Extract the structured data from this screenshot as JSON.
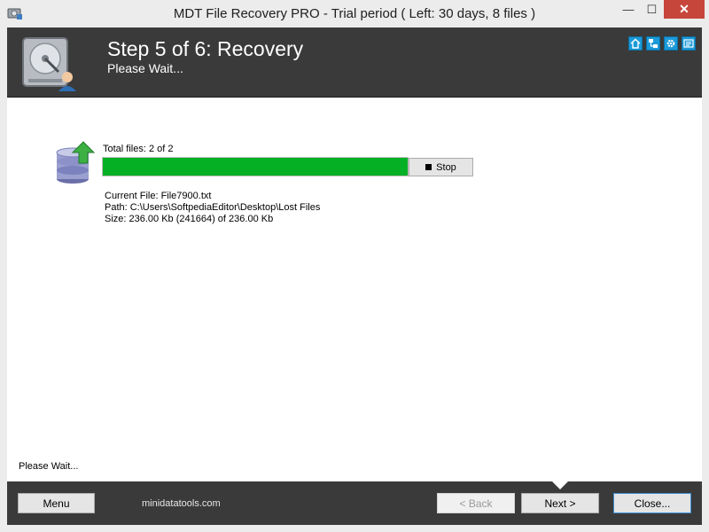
{
  "window": {
    "title": "MDT File Recovery PRO - Trial period ( Left: 30 days, 8 files )",
    "minimize_glyph": "—",
    "maximize_glyph": "☐",
    "close_glyph": "✕"
  },
  "header": {
    "step_title": "Step 5 of 6: Recovery",
    "step_subtitle": "Please Wait...",
    "icons": [
      "home-icon",
      "network-icon",
      "gear-icon",
      "info-card-icon"
    ]
  },
  "progress": {
    "total_label": "Total files: 2 of 2",
    "percent": 100,
    "fill_color": "#06b025",
    "stop_label": "Stop"
  },
  "details": {
    "current_file": "Current File: File7900.txt",
    "path": "Path: C:\\Users\\SoftpediaEditor\\Desktop\\Lost Files",
    "size": "Size: 236.00 Kb (241664) of 236.00 Kb"
  },
  "status": "Please Wait...",
  "footer": {
    "menu_label": "Menu",
    "site": "minidatatools.com",
    "back_label": "< Back",
    "next_label": "Next >",
    "close_label": "Close..."
  },
  "colors": {
    "header_bg": "#3a3a3a",
    "accent": "#1a9ad8"
  }
}
